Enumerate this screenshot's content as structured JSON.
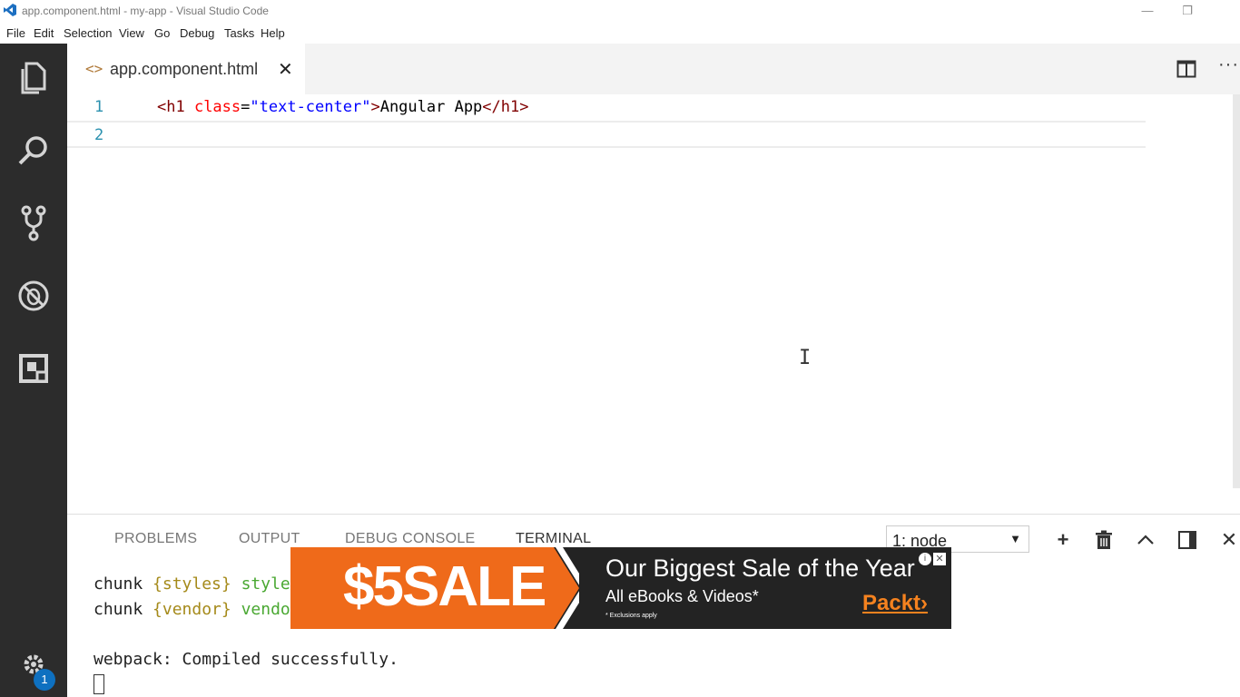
{
  "window": {
    "title": "app.component.html - my-app - Visual Studio Code",
    "minimize_glyph": "—",
    "restore_glyph": "❐"
  },
  "menu": [
    "File",
    "Edit",
    "Selection",
    "View",
    "Go",
    "Debug",
    "Tasks",
    "Help"
  ],
  "activity_bar": {
    "items": [
      "explorer-icon",
      "search-icon",
      "source-control-icon",
      "debug-icon",
      "extensions-icon"
    ],
    "settings_badge": "1"
  },
  "tabs": [
    {
      "label": "app.component.html",
      "icon": "<>",
      "close": "✕"
    }
  ],
  "editor_actions": {
    "more": "···"
  },
  "editor": {
    "lines": [
      {
        "number": "1",
        "tag_open_lt": "<h1 ",
        "attr": "class",
        "eq": "=",
        "str": "\"text-center\"",
        "gt": ">",
        "text": "Angular App",
        "tag_close": "</h1>"
      },
      {
        "number": "2"
      }
    ],
    "cursor_glyph": "I"
  },
  "panel": {
    "tabs": [
      "PROBLEMS",
      "OUTPUT",
      "DEBUG CONSOLE",
      "TERMINAL"
    ],
    "active_tab": "TERMINAL",
    "terminal_select": "1: node",
    "select_arrow": "▼",
    "actions": {
      "add": "+",
      "maximize": "^",
      "close": "✕"
    },
    "terminal_lines": [
      {
        "prefix": "chunk ",
        "brace": "{styles}",
        "rest": " style"
      },
      {
        "prefix": "chunk ",
        "brace": "{vendor}",
        "rest": " vendo"
      },
      {
        "text": "webpack: Compiled successfully."
      }
    ]
  },
  "ad": {
    "sale": "$5SALE",
    "headline": "Our Biggest Sale of the Year",
    "sub": "All eBooks & Videos*",
    "fine": "* Exclusions apply",
    "brand": "Packt›",
    "choice": "i",
    "close": "✕",
    "colors": {
      "orange": "#ef6a1a",
      "dark": "#232323"
    }
  }
}
